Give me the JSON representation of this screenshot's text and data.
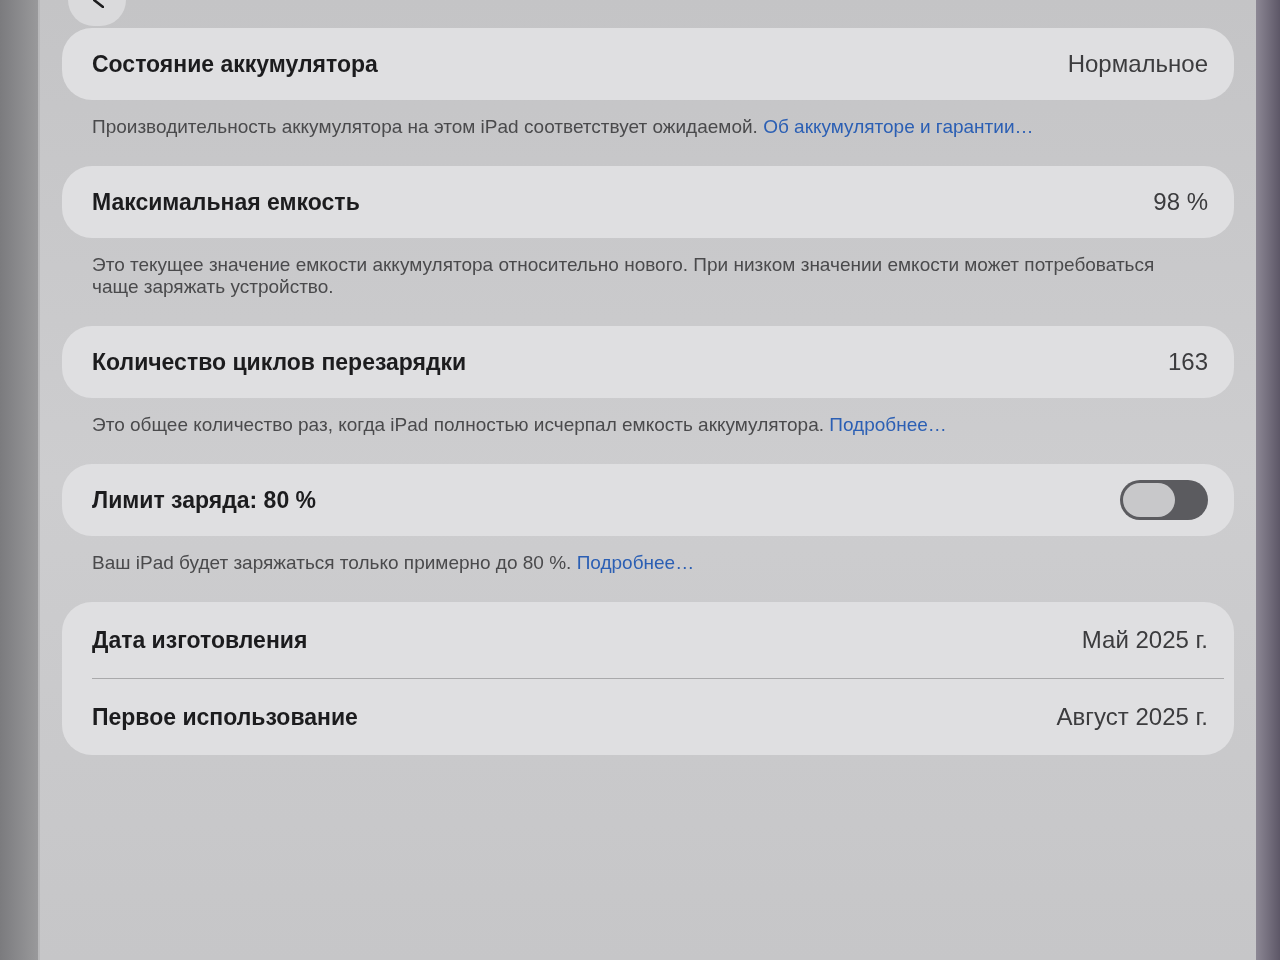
{
  "sections": [
    {
      "rows": [
        {
          "kind": "value",
          "label": "Состояние аккумулятора",
          "value": "Нормальное"
        }
      ],
      "footer": {
        "text": "Производительность аккумулятора на этом iPad соответствует ожидаемой.",
        "link": "Об аккумуляторе и гарантии…"
      }
    },
    {
      "rows": [
        {
          "kind": "value",
          "label": "Максимальная емкость",
          "value": "98 %"
        }
      ],
      "footer": {
        "text": "Это текущее значение емкости аккумулятора относительно нового. При низком значении емкости может потребоваться чаще заряжать устройство."
      }
    },
    {
      "rows": [
        {
          "kind": "value",
          "label": "Количество циклов перезарядки",
          "value": "163"
        }
      ],
      "footer": {
        "text": "Это общее количество раз, когда iPad полностью исчерпал емкость аккумулятора.",
        "link": "Подробнее…"
      }
    },
    {
      "rows": [
        {
          "kind": "toggle",
          "label": "Лимит заряда: 80 %",
          "on": false
        }
      ],
      "footer": {
        "text": "Ваш iPad будет заряжаться только примерно до 80 %.",
        "link": "Подробнее…"
      }
    },
    {
      "rows": [
        {
          "kind": "value",
          "label": "Дата изготовления",
          "value": "Май 2025 г."
        },
        {
          "kind": "value",
          "label": "Первое использование",
          "value": "Август 2025 г."
        }
      ]
    }
  ]
}
